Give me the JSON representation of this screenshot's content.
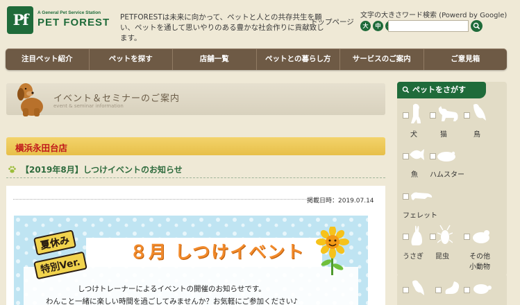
{
  "header": {
    "logo_mark": "Pf",
    "logo_tagline": "A General Pet Service Station",
    "logo_name": "PET FOREST",
    "tagline": "PETFORESTは未来に向かって、ペットと人との共存共生を願い、ペットを通して思いやりのある豊かな社会作りに貢献致します。",
    "top_link": "トップページ",
    "font_search_label": "文字の大きさワード検索 (Powerd by Google)",
    "size_large": "大",
    "size_medium": "中",
    "size_small": "小",
    "search_placeholder": ""
  },
  "nav": {
    "items": [
      {
        "label": "注目ペット紹介"
      },
      {
        "label": "ペットを探す"
      },
      {
        "label": "店舗一覧"
      },
      {
        "label": "ペットとの暮らし方"
      },
      {
        "label": "サービスのご案内"
      },
      {
        "label": "ご意見箱"
      }
    ]
  },
  "main": {
    "page_title": "イベント＆セミナーのご案内",
    "page_title_en": "event & seminar information",
    "store_name": "横浜永田台店",
    "article_title": "【2019年8月】しつけイベントのお知らせ",
    "post_date": "掲載日時：2019.07.14",
    "banner": {
      "badge_line1": "夏休み",
      "badge_line2": "特別Ver.",
      "event_title": "８月 しつけイベント",
      "invite_line1": "しつけトレーナーによるイベントの開催のお知らせです。",
      "invite_line2": "わんこと一緒に楽しい時間を過ごしてみませんか？お気軽にご参加ください♪"
    }
  },
  "sidebar": {
    "title": "ペットをさがす",
    "pets": [
      {
        "label": "犬",
        "icon": "dog-icon"
      },
      {
        "label": "猫",
        "icon": "cat-icon"
      },
      {
        "label": "鳥",
        "icon": "bird-icon"
      },
      {
        "label": "魚",
        "icon": "fish-icon"
      },
      {
        "label": "ハムスター",
        "icon": "hamster-icon"
      },
      {
        "label": "フェレット",
        "icon": "ferret-icon"
      },
      {
        "label": "うさぎ",
        "icon": "rabbit-icon"
      },
      {
        "label": "昆虫",
        "icon": "insect-icon"
      },
      {
        "label": "その他",
        "icon": "other-small-animal-icon"
      },
      {
        "label": "小動物",
        "icon": ""
      }
    ]
  },
  "colors": {
    "brand_green": "#1f6b3a",
    "nav_brown": "#6e5a45",
    "store_yellow": "#e7bf49",
    "store_red": "#c0181b",
    "background": "#efe9d6"
  }
}
